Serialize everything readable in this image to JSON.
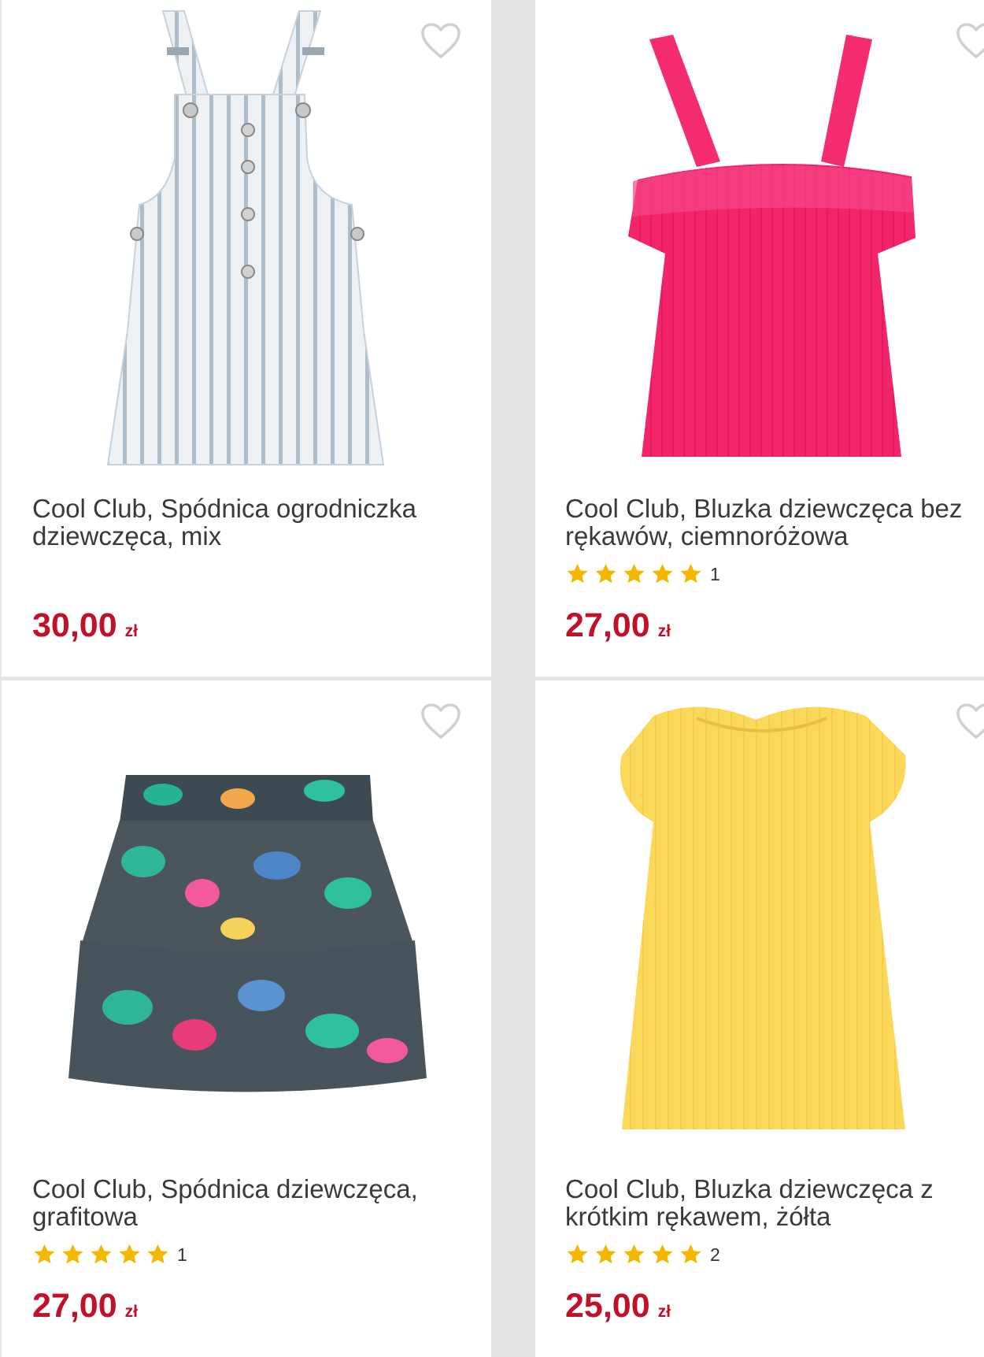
{
  "colors": {
    "price": "#c0102a",
    "star": "#f5b800",
    "heart_outline": "#cfcfcf",
    "text": "#3a3a3a"
  },
  "icons": {
    "favorite": "heart-outline-icon",
    "rating": "star-icon"
  },
  "products": [
    {
      "title": "Cool Club, Spódnica ogrodniczka dziewczęca, mix",
      "amount": "30,00",
      "currency": "zł",
      "rating": null,
      "review_count": "",
      "image": "striped-pinafore-dress"
    },
    {
      "title": "Cool Club, Bluzka dziewczęca bez rękawów, ciemnoróżowa",
      "amount": "27,00",
      "currency": "zł",
      "rating": 5,
      "review_count": "1",
      "image": "pink-ruffle-top"
    },
    {
      "title": "Cool Club, Spódnica dziewczęca, grafitowa",
      "amount": "27,00",
      "currency": "zł",
      "rating": 5,
      "review_count": "1",
      "image": "floral-tiered-skirt"
    },
    {
      "title": "Cool Club, Bluzka dziewczęca z krótkim rękawem, żółta",
      "amount": "25,00",
      "currency": "zł",
      "rating": 5,
      "review_count": "2",
      "image": "yellow-short-sleeve-top"
    }
  ]
}
